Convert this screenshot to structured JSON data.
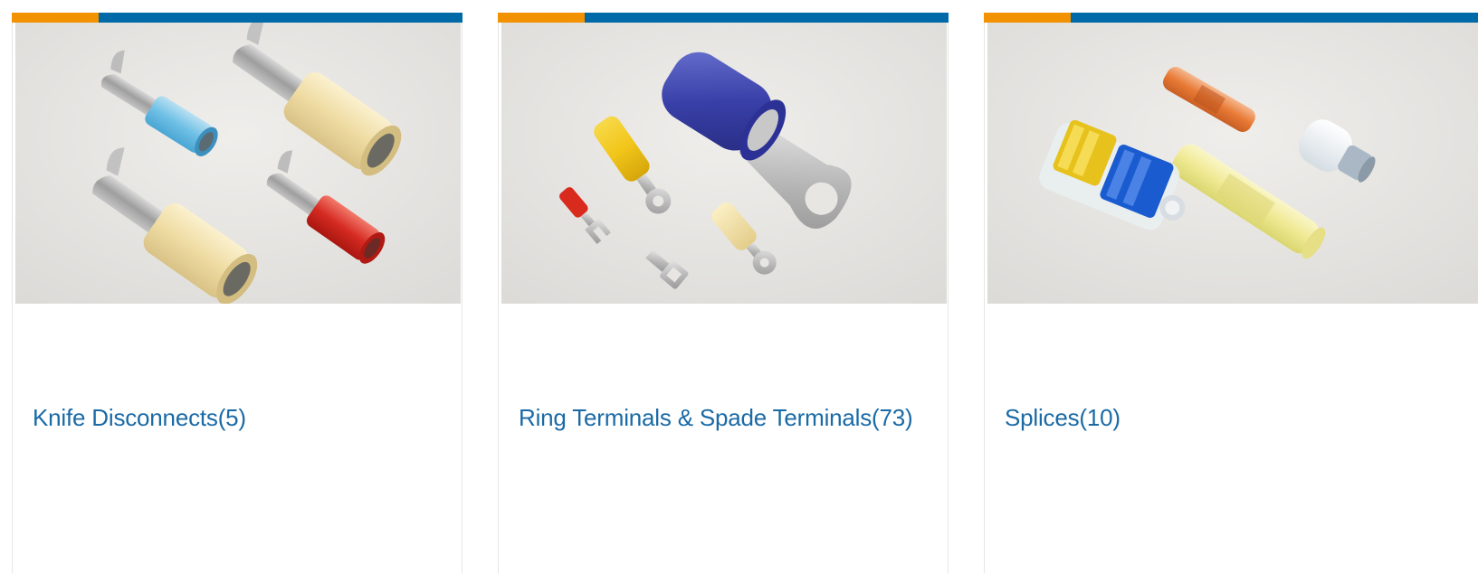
{
  "theme": {
    "accent_orange": "#f39200",
    "accent_blue": "#0069a7",
    "link_color": "#1a6aa6"
  },
  "categories": [
    {
      "title": "Knife Disconnects(5)",
      "image_name": "knife-disconnects-photo"
    },
    {
      "title": "Ring Terminals & Spade Terminals(73)",
      "image_name": "ring-spade-terminals-photo"
    },
    {
      "title": "Splices(10)",
      "image_name": "splices-photo"
    }
  ]
}
